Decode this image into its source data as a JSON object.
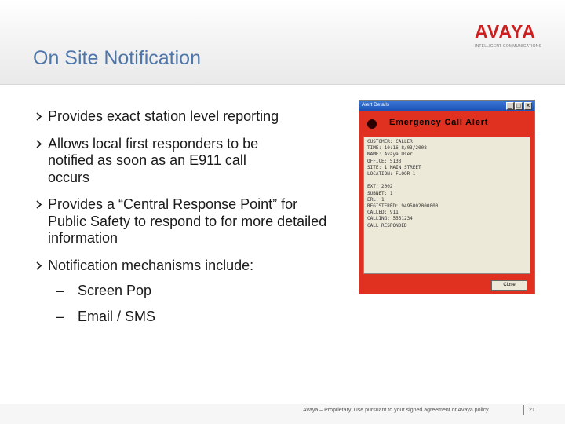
{
  "slide": {
    "title": "On Site Notification"
  },
  "logo": {
    "word": "AVAYA",
    "tagline": "INTELLIGENT COMMUNICATIONS"
  },
  "bullets": [
    "Provides exact station level reporting",
    "Allows local first responders to be notified as soon as an E911 call occurs",
    "Provides a “Central Response Point” for Public Safety to respond to for more detailed information",
    "Notification mechanisms include:"
  ],
  "sub_bullets": [
    "Screen Pop",
    "Email / SMS"
  ],
  "alert_window": {
    "title": "Alert Details",
    "heading": "Emergency Call Alert",
    "lines": [
      "CUSTOMER: CALLER",
      "TIME: 10:16 8/03/2008",
      "NAME: Avaya User",
      "OFFICE: 5133",
      "SITE: 1 MAIN STREET",
      "LOCATION: FLOOR 1",
      "",
      "EXT: 2002",
      "SUBNET: 1",
      "ERL: 1",
      "REGISTERED: 9495002000000",
      "CALLED: 911",
      "CALLING: 5551234",
      "CALL RESPONDED"
    ],
    "button_label": "Close"
  },
  "footer": {
    "text": "Avaya – Proprietary. Use pursuant to your signed agreement or Avaya policy.",
    "page": "21"
  },
  "colors": {
    "title": "#4f76a8",
    "brand_red": "#cc1f1f",
    "alert_bg": "#e0301f"
  }
}
